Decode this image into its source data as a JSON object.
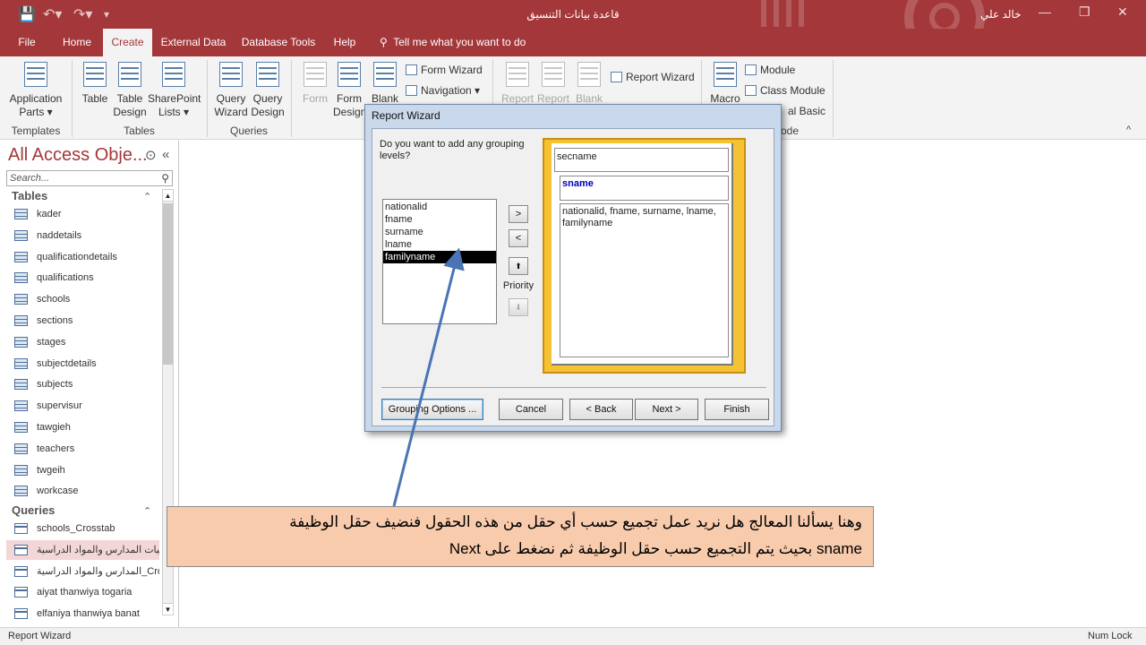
{
  "window": {
    "title": "قاعدة بيانات التنسيق",
    "user": "خالد علي"
  },
  "quick_access": {
    "save_icon": "save-icon",
    "undo_icon": "undo-icon",
    "redo_icon": "redo-icon",
    "customize_icon": "customize-icon"
  },
  "tabs": [
    {
      "label": "File"
    },
    {
      "label": "Home"
    },
    {
      "label": "Create"
    },
    {
      "label": "External Data"
    },
    {
      "label": "Database Tools"
    },
    {
      "label": "Help"
    }
  ],
  "active_tab": "Create",
  "tellme": "Tell me what you want to do",
  "ribbon": {
    "app_parts": "Application Parts ▾",
    "table": "Table",
    "table_design": "Table Design",
    "sharepoint_lists": "SharePoint Lists ▾",
    "query_wizard": "Query Wizard",
    "query_design": "Query Design",
    "form": "Form",
    "form_design": "Form Design",
    "blank_form": "Blank",
    "form_wizard": "Form Wizard",
    "navigation": "Navigation ▾",
    "report": "Report",
    "report_design": "Report",
    "blank_report": "Blank",
    "report_wizard": "Report Wizard",
    "macro": "Macro",
    "module": "Module",
    "class_module": "Class Module",
    "visual_basic": "al Basic",
    "groups": {
      "templates": "Templates",
      "tables": "Tables",
      "queries": "Queries",
      "code": "ode"
    }
  },
  "nav": {
    "title": "All Access Obje...",
    "search_placeholder": "Search...",
    "tables_header": "Tables",
    "tables": [
      "kader",
      "naddetails",
      "qualificationdetails",
      "qualifications",
      "schools",
      "sections",
      "stages",
      "subjectdetails",
      "subjects",
      "supervisur",
      "tawgieh",
      "teachers",
      "twgeih",
      "workcase"
    ],
    "queries_header": "Queries",
    "queries": [
      "schools_Crosstab",
      "احصائيات المدارس والمواد الدراسية",
      "المدارس والمواد الدراسية_Crosst...",
      "aiyat thanwiya togaria",
      "elfaniya thanwiya banat"
    ]
  },
  "dialog": {
    "title": "Report Wizard",
    "prompt": "Do you want to add any grouping levels?",
    "fields": [
      "nationalid",
      "fname",
      "surname",
      "lname",
      "familyname"
    ],
    "selected_field": "familyname",
    "btn_add": ">",
    "btn_remove": "<",
    "priority_label": "Priority",
    "preview": {
      "level1": "secname",
      "level2": "sname",
      "detail": "nationalid, fname, surname, lname, familyname"
    },
    "buttons": {
      "grouping": "Grouping Options ...",
      "cancel": "Cancel",
      "back": "< Back",
      "next": "Next >",
      "finish": "Finish"
    }
  },
  "callout": {
    "line1": "وهنا يسألنا المعالج هل نريد عمل تجميع حسب أي حقل من هذه الحقول فنضيف حقل الوظيفة",
    "line2": "sname بحيث يتم التجميع حسب حقل الوظيفة ثم نضغط على Next"
  },
  "status": {
    "left": "Report Wizard",
    "right": "Num Lock"
  },
  "colors": {
    "accent": "#a4373a",
    "callout": "#f8cbad",
    "preview": "#f4c232",
    "arrow": "#4a74b4"
  }
}
